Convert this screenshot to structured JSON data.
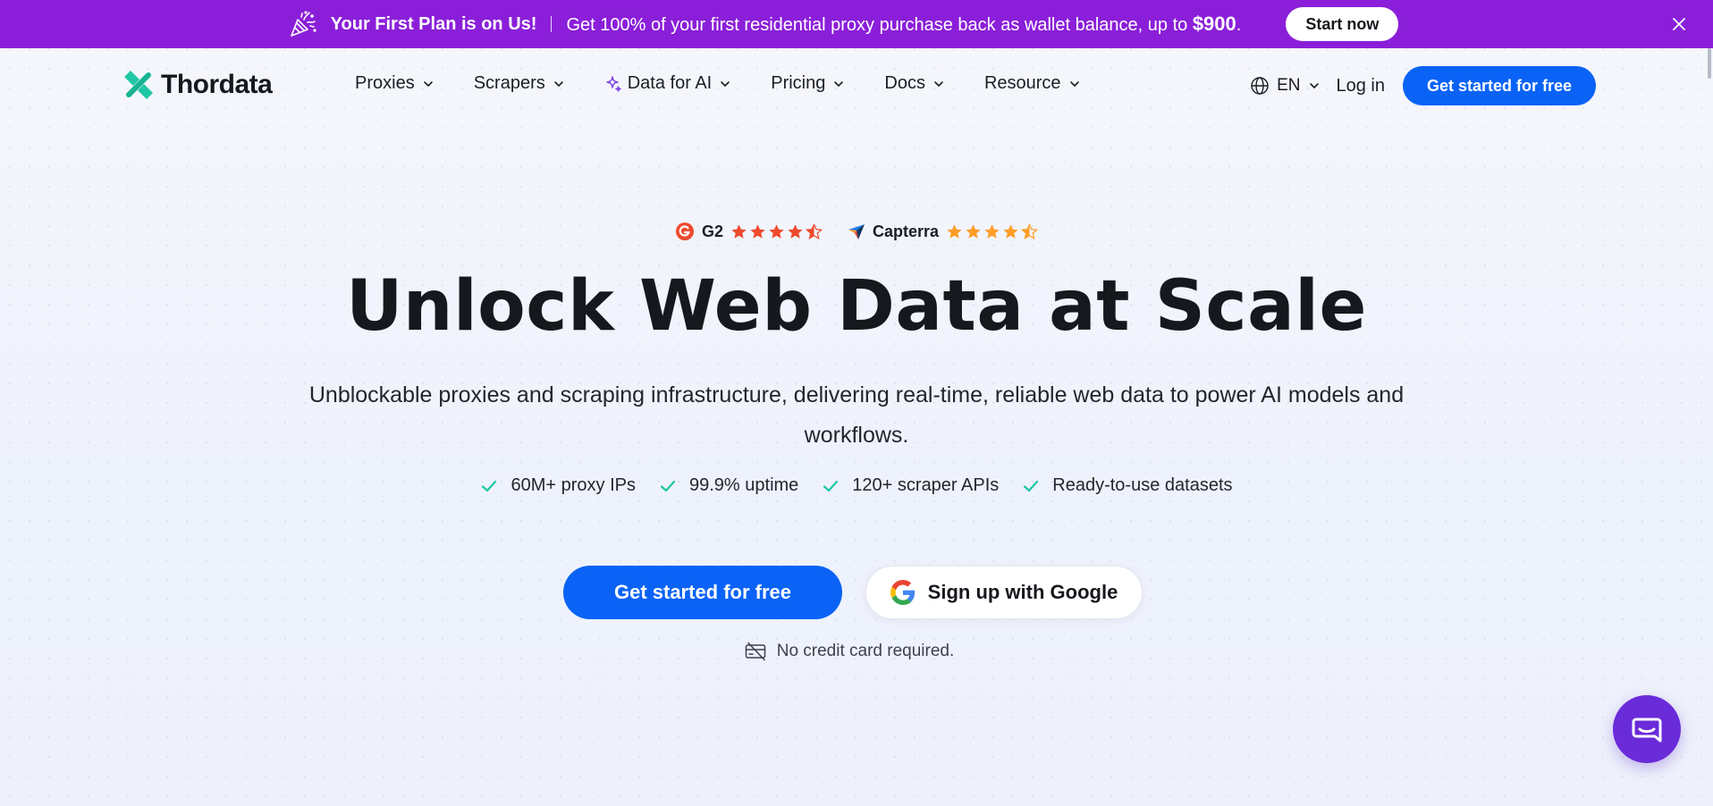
{
  "promo": {
    "headline": "Your First Plan is on Us!",
    "offer_text": "Get 100% of your first residential proxy purchase back as wallet balance, up to ",
    "offer_amount": "$900",
    "offer_end": ".",
    "cta": "Start now",
    "background_color": "#8b1fd9"
  },
  "nav": {
    "brand": "Thordata",
    "menu": [
      {
        "label": "Proxies"
      },
      {
        "label": "Scrapers"
      },
      {
        "label": "Data for AI",
        "icon": "sparkle-icon"
      },
      {
        "label": "Pricing"
      },
      {
        "label": "Docs"
      },
      {
        "label": "Resource"
      }
    ],
    "language": "EN",
    "login": "Log in",
    "cta": "Get started for free"
  },
  "hero": {
    "ratings": [
      {
        "name": "G2",
        "stars": 4.5,
        "icon": "g2-logo-icon",
        "star_color": "#ef4a2e"
      },
      {
        "name": "Capterra",
        "stars": 4.5,
        "icon": "capterra-logo-icon",
        "star_color": "#ff9d28"
      }
    ],
    "title": "Unlock Web Data at Scale",
    "subtitle": "Unblockable proxies and scraping infrastructure, delivering real-time, reliable web data to power AI models and workflows.",
    "features": [
      "60M+ proxy IPs",
      "99.9% uptime",
      "120+ scraper APIs",
      "Ready-to-use datasets"
    ],
    "primary_cta": "Get started for free",
    "google_cta": "Sign up with Google",
    "note": "No credit card required."
  },
  "colors": {
    "accent": "#0a63f6",
    "check": "#1cc6a3",
    "chat": "#6a2bd9"
  }
}
